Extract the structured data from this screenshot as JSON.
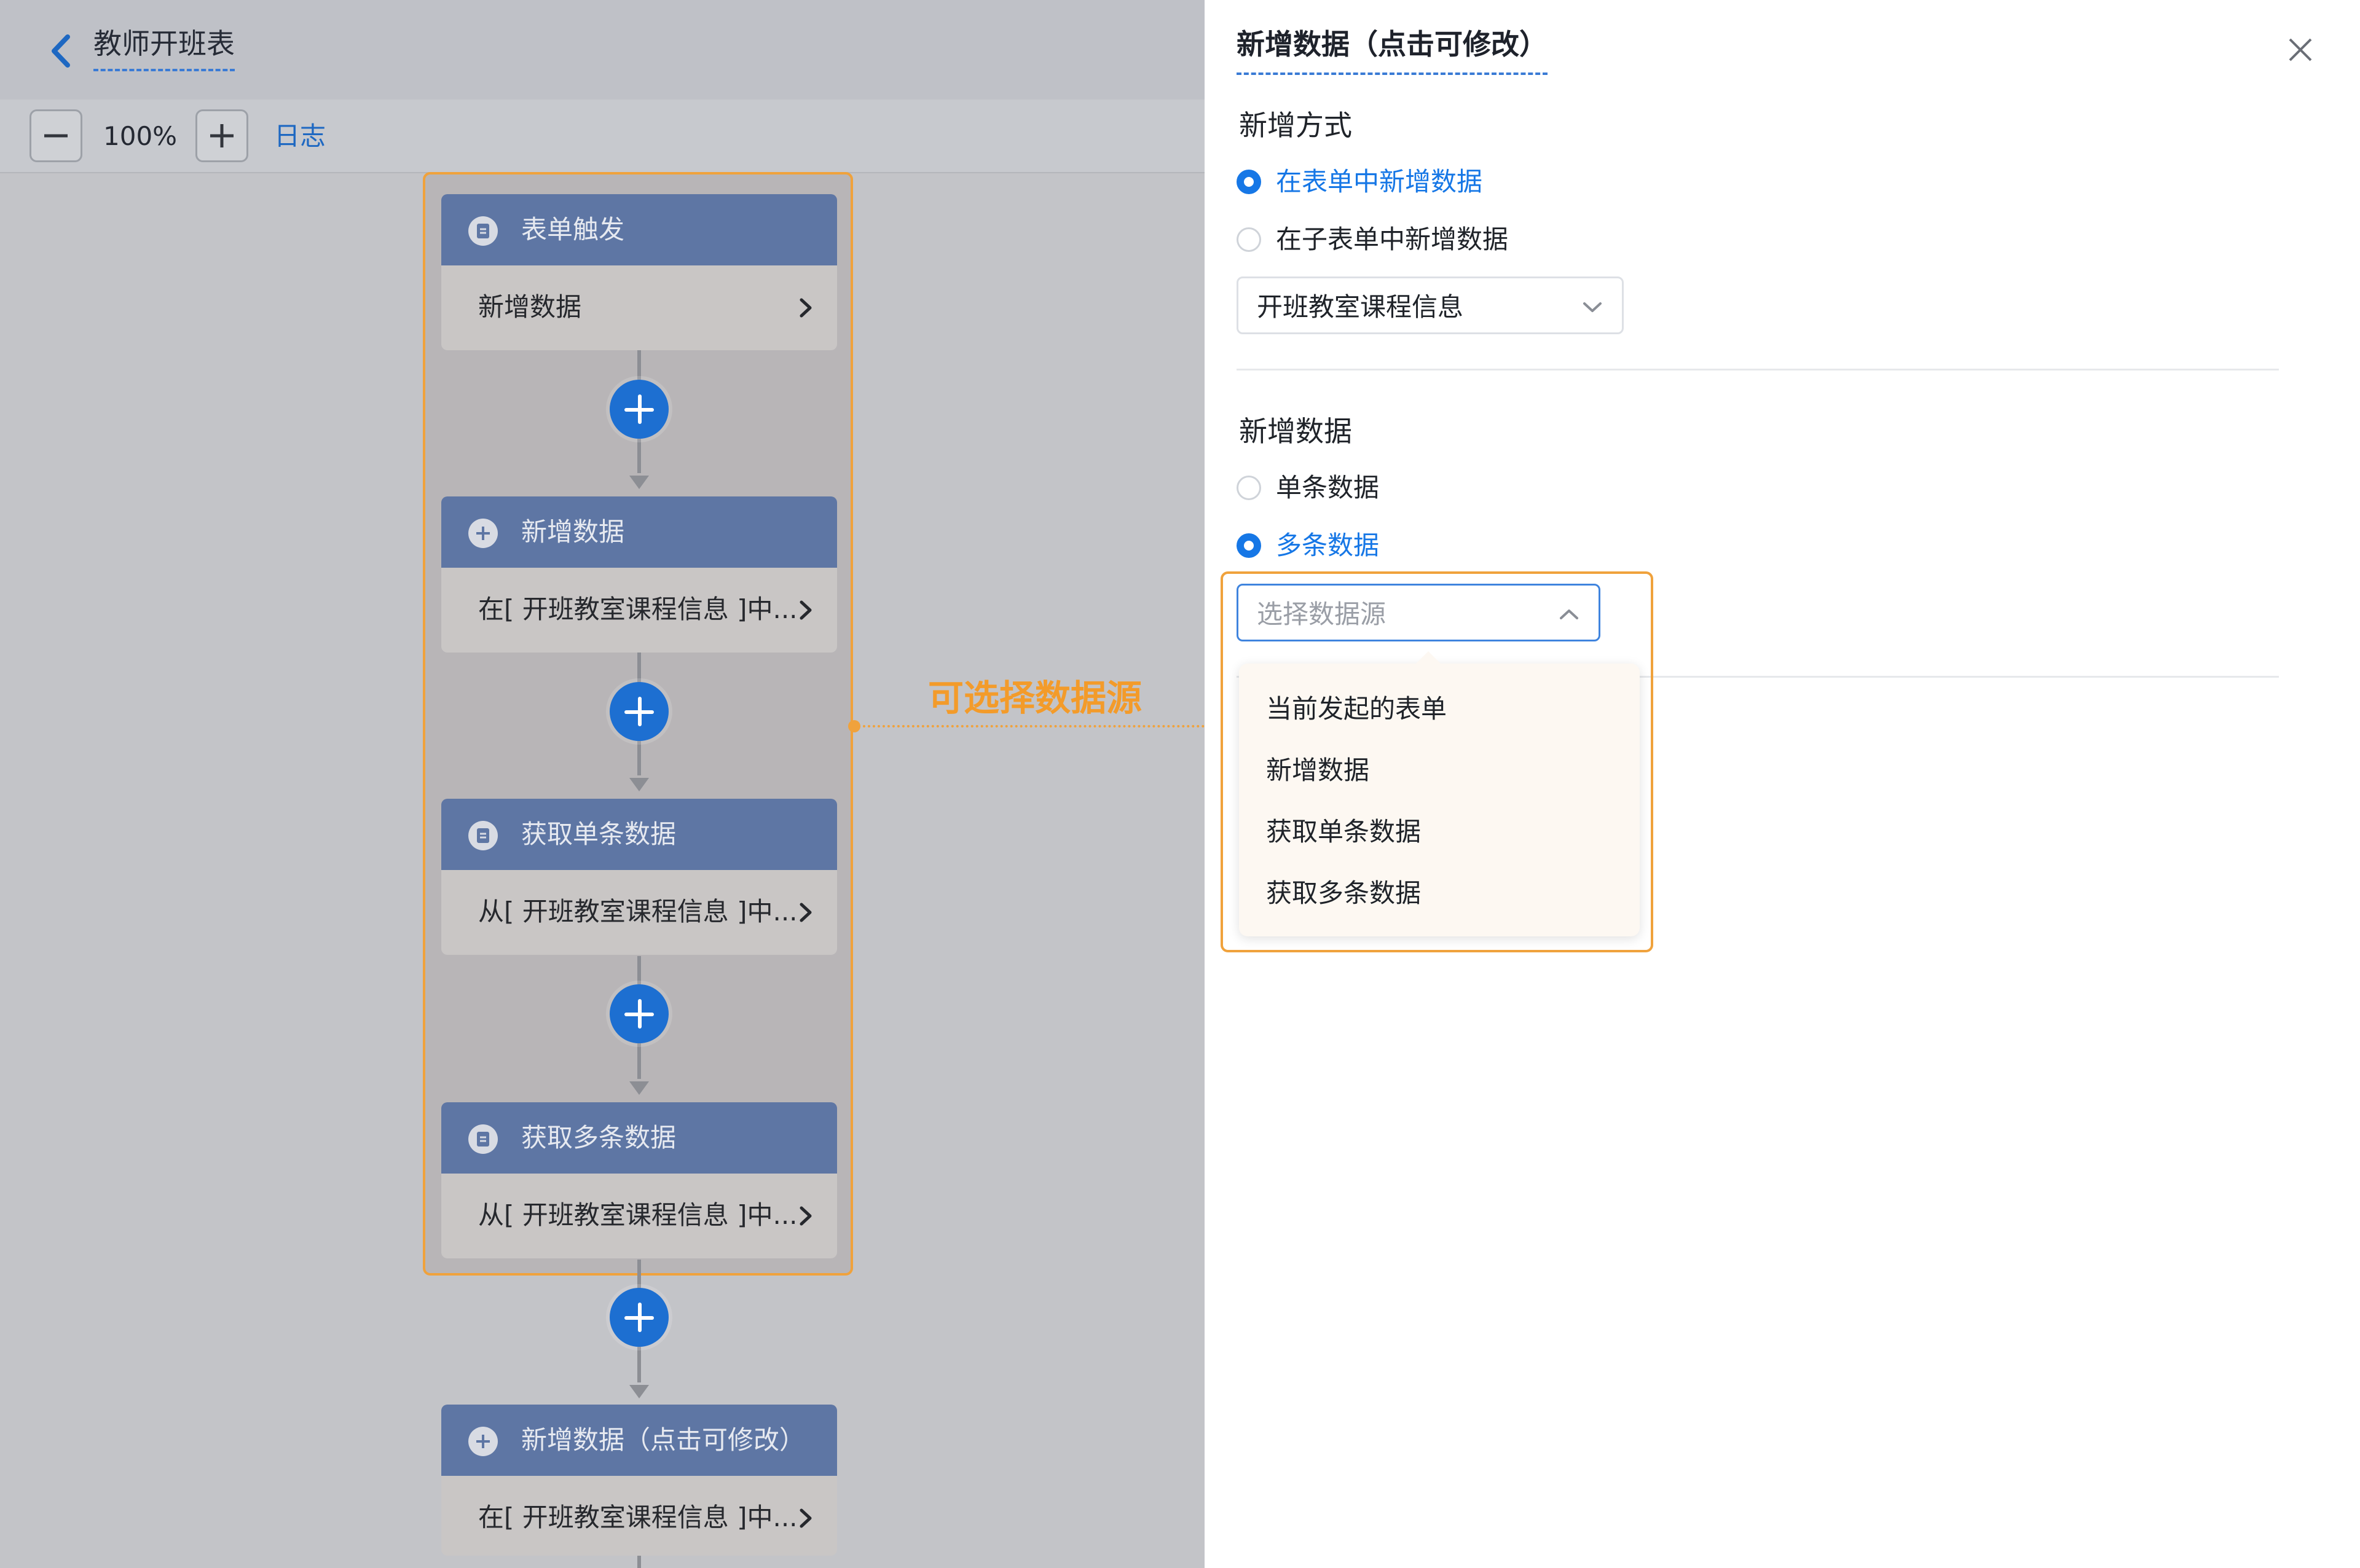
{
  "header": {
    "title": "教师开班表"
  },
  "toolbar": {
    "zoom_value": "100%",
    "log_label": "日志"
  },
  "workflow": {
    "nodes": [
      {
        "title": "表单触发",
        "body": "新增数据",
        "icon": "document-icon"
      },
      {
        "title": "新增数据",
        "body": "在[ 开班教室课程信息 ]中...",
        "icon": "plus-circle-icon"
      },
      {
        "title": "获取单条数据",
        "body": "从[ 开班教室课程信息 ]中...",
        "icon": "document-icon"
      },
      {
        "title": "获取多条数据",
        "body": "从[ 开班教室课程信息 ]中...",
        "icon": "document-icon"
      },
      {
        "title": "新增数据（点击可修改）",
        "body": "在[ 开班教室课程信息 ]中...",
        "icon": "plus-circle-icon"
      }
    ],
    "annotation": "可选择数据源"
  },
  "panel": {
    "title": "新增数据（点击可修改）",
    "method_heading": "新增方式",
    "method_options": [
      {
        "label": "在表单中新增数据",
        "selected": true
      },
      {
        "label": "在子表单中新增数据",
        "selected": false
      }
    ],
    "form_select_value": "开班教室课程信息",
    "data_heading": "新增数据",
    "data_options": [
      {
        "label": "单条数据",
        "selected": false
      },
      {
        "label": "多条数据",
        "selected": true
      }
    ],
    "datasource_placeholder": "选择数据源",
    "datasource_options": [
      "当前发起的表单",
      "新增数据",
      "获取单条数据",
      "获取多条数据"
    ]
  },
  "colors": {
    "accent": "#1677e6",
    "node_header": "#5e76a4",
    "highlight": "#f0a23c",
    "plus_button": "#1d6fd1"
  }
}
